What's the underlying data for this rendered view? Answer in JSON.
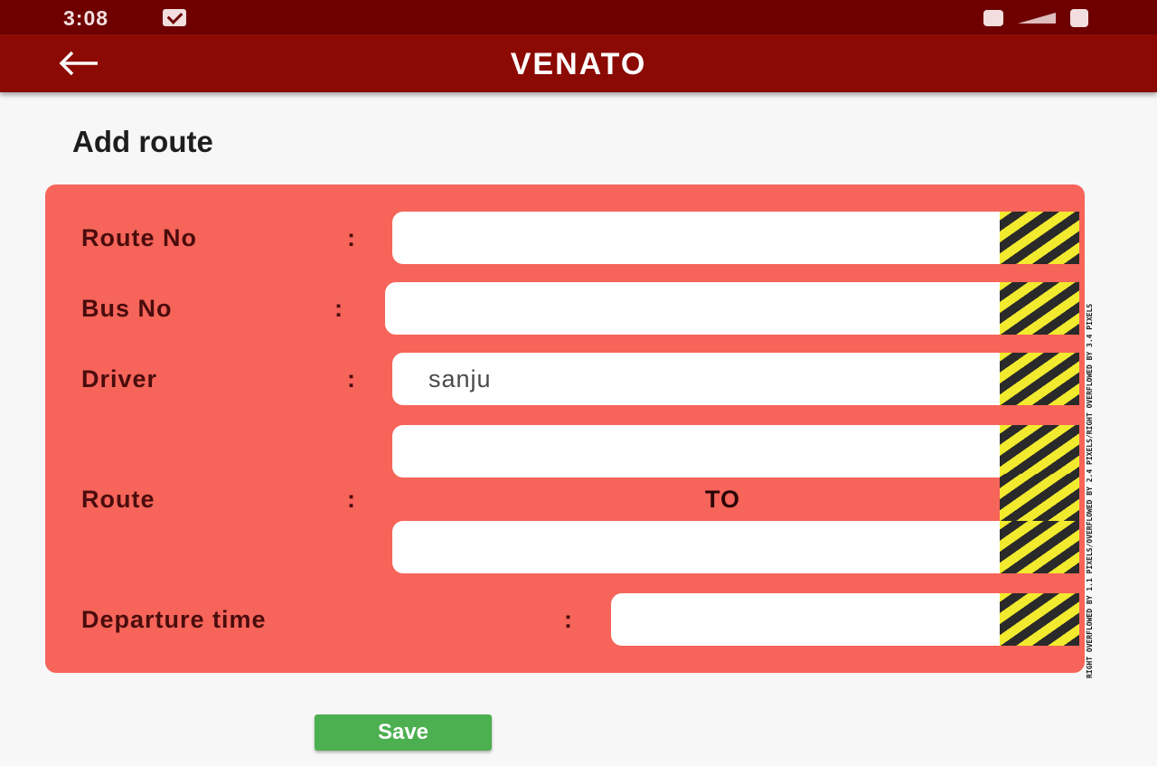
{
  "status_bar": {
    "time": "3:08",
    "icons": [
      "message-icon",
      "notification-icon",
      "wifi-icon",
      "signal-icon",
      "battery-icon"
    ]
  },
  "app_bar": {
    "title": "VENATO",
    "back_icon": "arrow-left-icon",
    "background_color": "#8b0a03"
  },
  "page": {
    "title": "Add route"
  },
  "form": {
    "background_color": "#f6645a",
    "route_no": {
      "label": "Route No",
      "colon": ":",
      "value": ""
    },
    "bus_no": {
      "label": "Bus No",
      "colon": ":",
      "value": ""
    },
    "driver": {
      "label": "Driver",
      "colon": ":",
      "value": "sanju"
    },
    "route": {
      "label": "Route",
      "colon": ":",
      "from_value": "",
      "to_label": "TO",
      "to_value": ""
    },
    "departure_time": {
      "label": "Departure time",
      "colon": ":",
      "value": ""
    }
  },
  "save_button": {
    "label": "Save",
    "color": "#4caf50"
  },
  "overflow_debug_text": "RIGHT OVERFLOWED BY 1.1 PIXELS/OVERFLOWED BY 2.4 PIXELS/RIGHT OVERFLOWED BY 3.4 PIXELS"
}
